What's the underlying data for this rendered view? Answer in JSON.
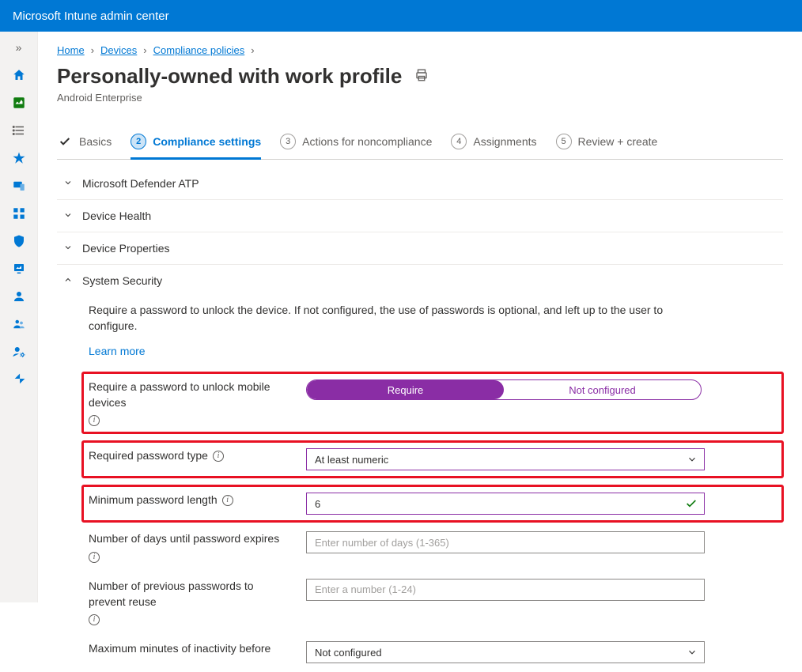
{
  "header": {
    "title": "Microsoft Intune admin center"
  },
  "breadcrumbs": {
    "items": [
      {
        "label": "Home"
      },
      {
        "label": "Devices"
      },
      {
        "label": "Compliance policies"
      }
    ]
  },
  "page": {
    "title": "Personally-owned with work profile",
    "subtitle": "Android Enterprise"
  },
  "tabs": {
    "items": [
      {
        "label": "Basics"
      },
      {
        "label": "Compliance settings",
        "num": "2"
      },
      {
        "label": "Actions for noncompliance",
        "num": "3"
      },
      {
        "label": "Assignments",
        "num": "4"
      },
      {
        "label": "Review + create",
        "num": "5"
      }
    ]
  },
  "sections": {
    "defender": "Microsoft Defender ATP",
    "health": "Device Health",
    "properties": "Device Properties",
    "security": "System Security"
  },
  "security": {
    "description": "Require a password to unlock the device. If not configured, the use of passwords is optional, and left up to the user to configure.",
    "learn_more": "Learn more",
    "fields": {
      "require_password": {
        "label": "Require a password to unlock mobile devices",
        "opt_require": "Require",
        "opt_notconf": "Not configured"
      },
      "password_type": {
        "label": "Required password type",
        "value": "At least numeric"
      },
      "min_length": {
        "label": "Minimum password length",
        "value": "6"
      },
      "expire_days": {
        "label": "Number of days until password expires",
        "placeholder": "Enter number of days (1-365)"
      },
      "previous_reuse": {
        "label": "Number of previous passwords to prevent reuse",
        "placeholder": "Enter a number (1-24)"
      },
      "inactivity": {
        "label": "Maximum minutes of inactivity before",
        "value": "Not configured"
      }
    }
  }
}
